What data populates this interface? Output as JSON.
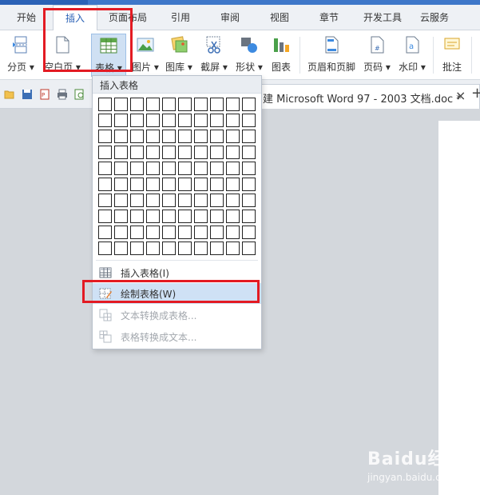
{
  "tabs": [
    {
      "label": "开始",
      "active": false
    },
    {
      "label": "插入",
      "active": true
    },
    {
      "label": "页面布局",
      "active": false
    },
    {
      "label": "引用",
      "active": false
    },
    {
      "label": "审阅",
      "active": false
    },
    {
      "label": "视图",
      "active": false
    },
    {
      "label": "章节",
      "active": false
    },
    {
      "label": "开发工具",
      "active": false
    },
    {
      "label": "云服务",
      "active": false
    }
  ],
  "ribbon": {
    "page_break": "分页",
    "blank_page": "空白页",
    "table": "表格",
    "picture": "图片",
    "gallery": "图库",
    "screenshot": "截屏",
    "shapes": "形状",
    "chart": "图表",
    "header_footer": "页眉和页脚",
    "page_number": "页码",
    "watermark": "水印",
    "comment": "批注"
  },
  "document_tab": {
    "title": "建 Microsoft Word 97 - 2003 文档.doc *",
    "close": "×",
    "new_tab": "+"
  },
  "table_menu": {
    "header": "插入表格",
    "grid_cols": 10,
    "grid_rows": 10,
    "items": [
      {
        "label": "插入表格(I)",
        "enabled": true,
        "highlighted": false,
        "icon": "table-icon"
      },
      {
        "label": "绘制表格(W)",
        "enabled": true,
        "highlighted": true,
        "icon": "draw-table-icon"
      },
      {
        "label": "文本转换成表格...",
        "enabled": false,
        "highlighted": false,
        "icon": "text-to-table-icon"
      },
      {
        "label": "表格转换成文本...",
        "enabled": false,
        "highlighted": false,
        "icon": "table-to-text-icon"
      }
    ]
  },
  "watermark": {
    "brand": "Baidu经验",
    "url": "jingyan.baidu.com"
  },
  "colors": {
    "accent": "#2b62b6",
    "highlight_box": "#e31b23",
    "menu_highlight": "#cfe1f5"
  }
}
